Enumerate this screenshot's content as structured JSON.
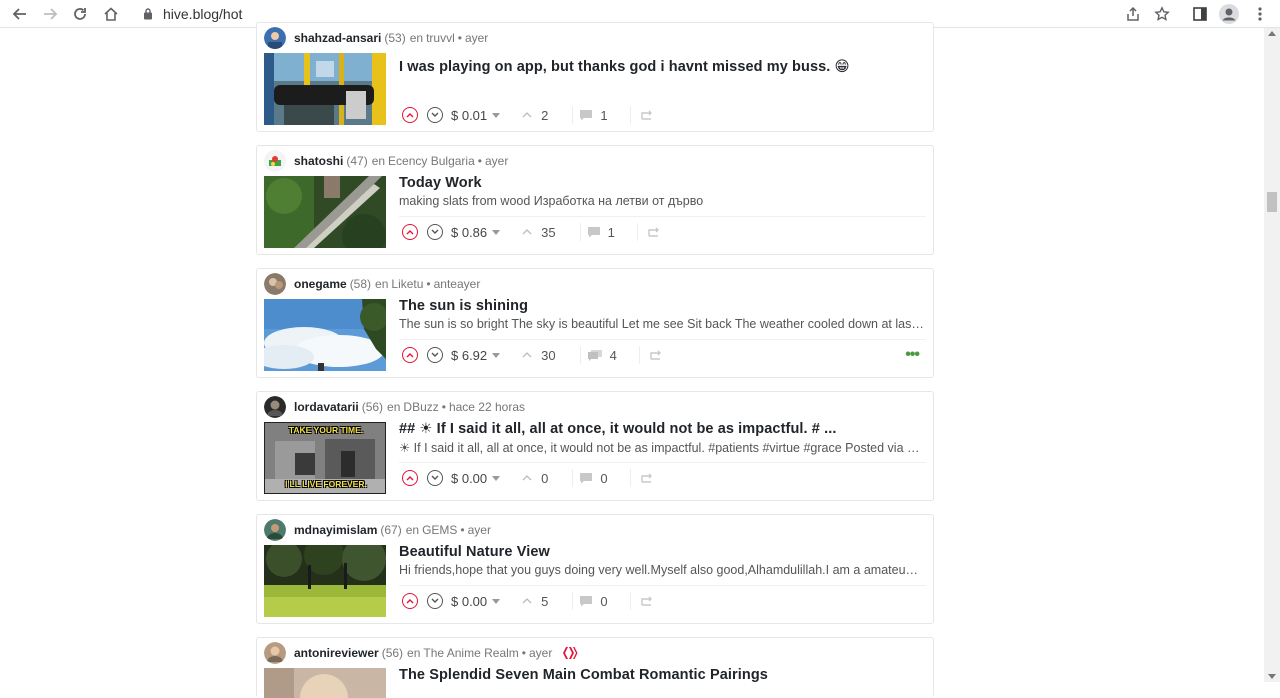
{
  "browser": {
    "url": "hive.blog/hot"
  },
  "posts": [
    {
      "author": "shahzad-ansari",
      "rep": "(53)",
      "community_prefix": "en",
      "community": "truvvl",
      "time": "ayer",
      "title": "I was playing on app, but thanks god i havnt missed my buss. 😁",
      "summary": "",
      "payout": "$ 0.01",
      "votes": "2",
      "comments": "1"
    },
    {
      "author": "shatoshi",
      "rep": "(47)",
      "community_prefix": "en",
      "community": "Ecency Bulgaria",
      "time": "ayer",
      "title": "Today Work",
      "summary": "making slats from wood Изработка на летви от дърво",
      "payout": "$ 0.86",
      "votes": "35",
      "comments": "1"
    },
    {
      "author": "onegame",
      "rep": "(58)",
      "community_prefix": "en",
      "community": "Liketu",
      "time": "anteayer",
      "title": "The sun is shining",
      "summary": "The sun is so bright The sky is beautiful Let me see Sit back The weather cooled down at last…",
      "payout": "$ 6.92",
      "votes": "30",
      "comments": "4",
      "more": "•••"
    },
    {
      "author": "lordavatarii",
      "rep": "(56)",
      "community_prefix": "en",
      "community": "DBuzz",
      "time": "hace 22 horas",
      "title": "## ☀ If I said it all, all at once, it would not be as impactful. # ...",
      "summary": "☀ If I said it all, all at once, it would not be as impactful. #patients #virtue #grace Posted via …",
      "thumb_text_top": "TAKE YOUR TIME.",
      "thumb_text_bottom": "I'LL LIVE FOREVER.",
      "payout": "$ 0.00",
      "votes": "0",
      "comments": "0"
    },
    {
      "author": "mdnayimislam",
      "rep": "(67)",
      "community_prefix": "en",
      "community": "GEMS",
      "time": "ayer",
      "title": "Beautiful Nature View",
      "summary": "Hi friends,hope that you guys doing very well.Myself also good,Alhamdulillah.I am a amateu…",
      "payout": "$ 0.00",
      "votes": "5",
      "comments": "0"
    },
    {
      "author": "antonireviewer",
      "rep": "(56)",
      "community_prefix": "en",
      "community": "The Anime Realm",
      "time": "ayer",
      "title": "The Splendid Seven Main Combat Romantic Pairings",
      "summary": ""
    }
  ],
  "colors": {
    "upvote": "#e31337",
    "accent_green": "#4a9b3f"
  }
}
